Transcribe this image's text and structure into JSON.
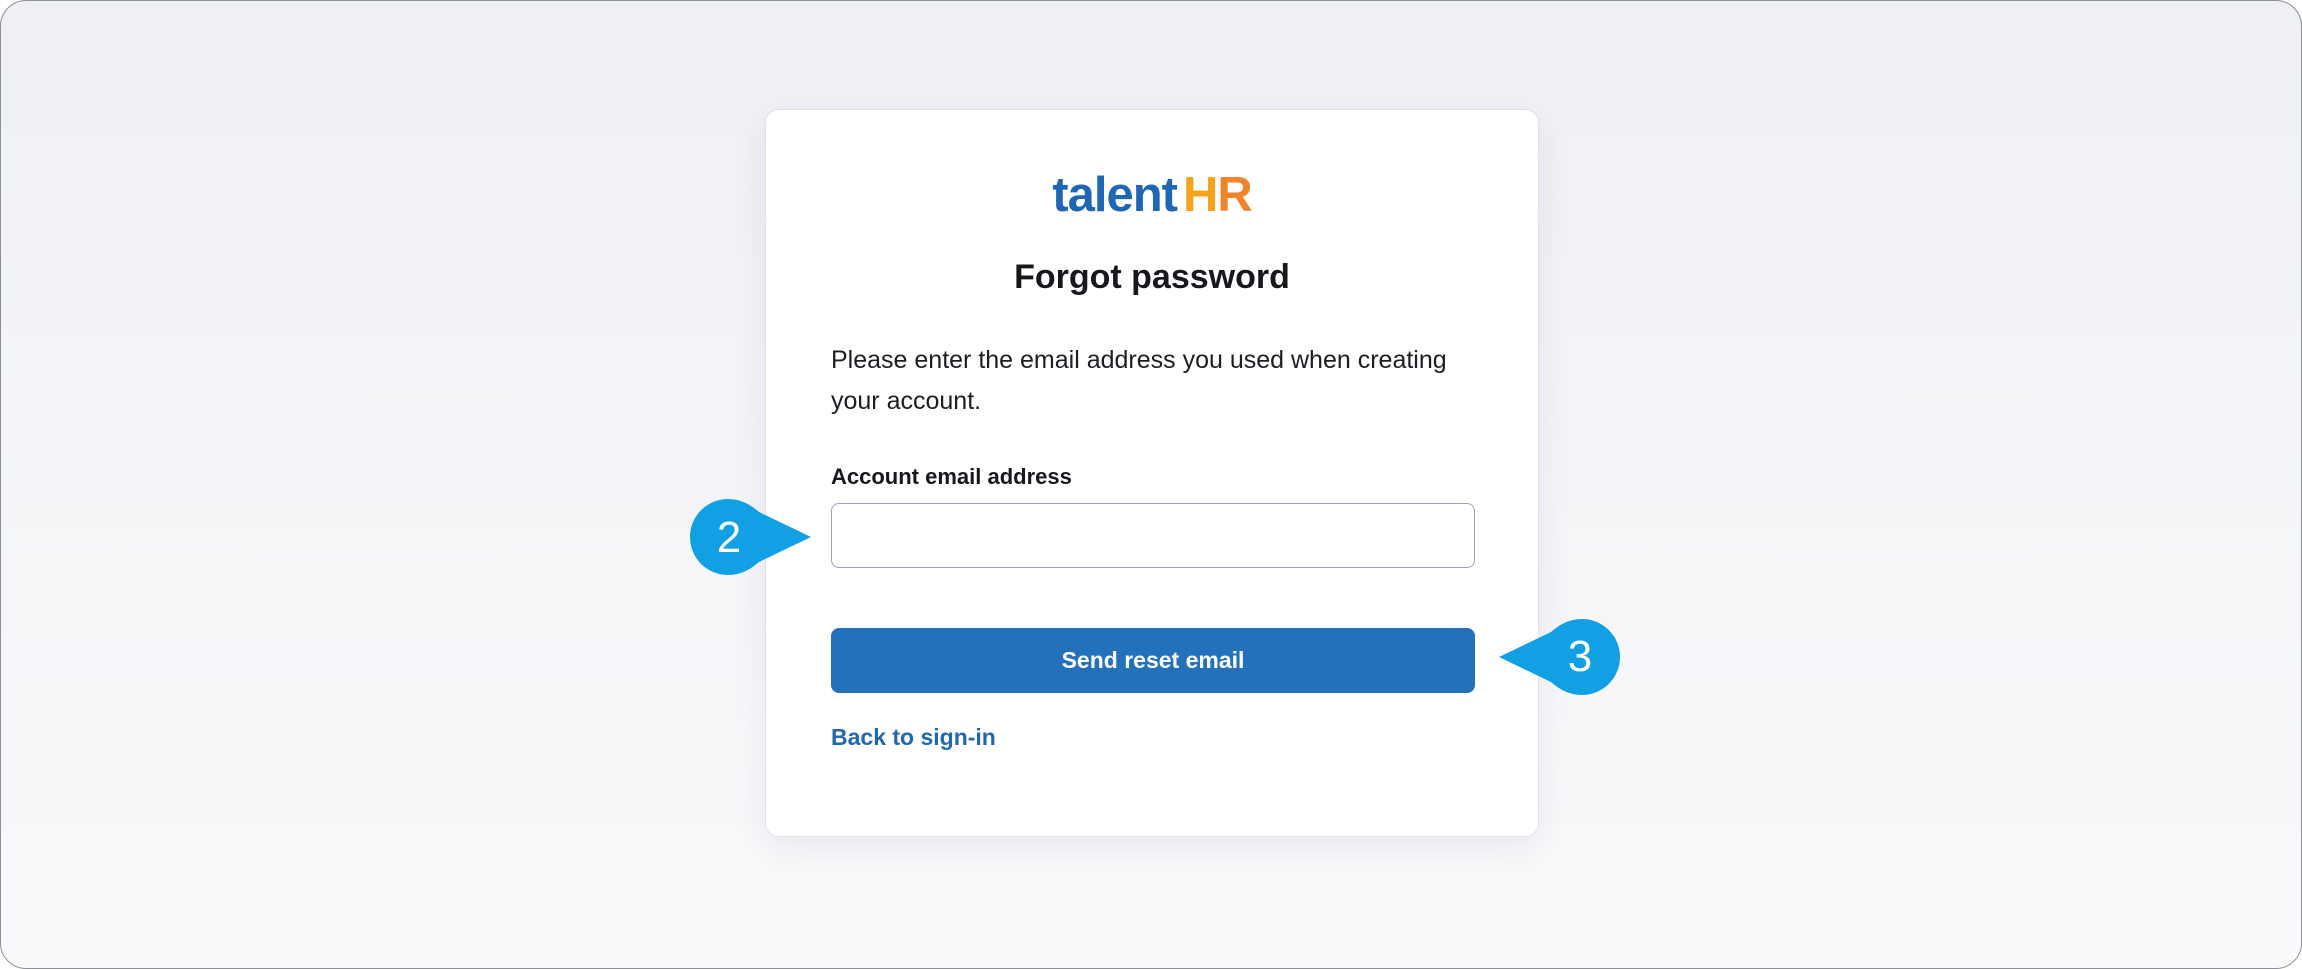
{
  "logo": {
    "word": "talent",
    "mark_h": "H",
    "mark_r": "R",
    "colors": {
      "word": "#1f66b4",
      "mark_h": "#f7a21b",
      "mark_r": "#f0842a"
    }
  },
  "form": {
    "title": "Forgot password",
    "description": "Please enter the email address you used when creating your account.",
    "email_label": "Account email address",
    "email_value": "",
    "email_placeholder": "",
    "submit_label": "Send reset email",
    "back_link_label": "Back to sign-in"
  },
  "callouts": [
    {
      "number": "2",
      "color": "#10a0e3",
      "points_to": "email-input"
    },
    {
      "number": "3",
      "color": "#10a0e3",
      "points_to": "send-reset-email-button"
    }
  ],
  "colors": {
    "accent": "#2371bb",
    "link": "#2168b0",
    "callout": "#10a0e3"
  }
}
